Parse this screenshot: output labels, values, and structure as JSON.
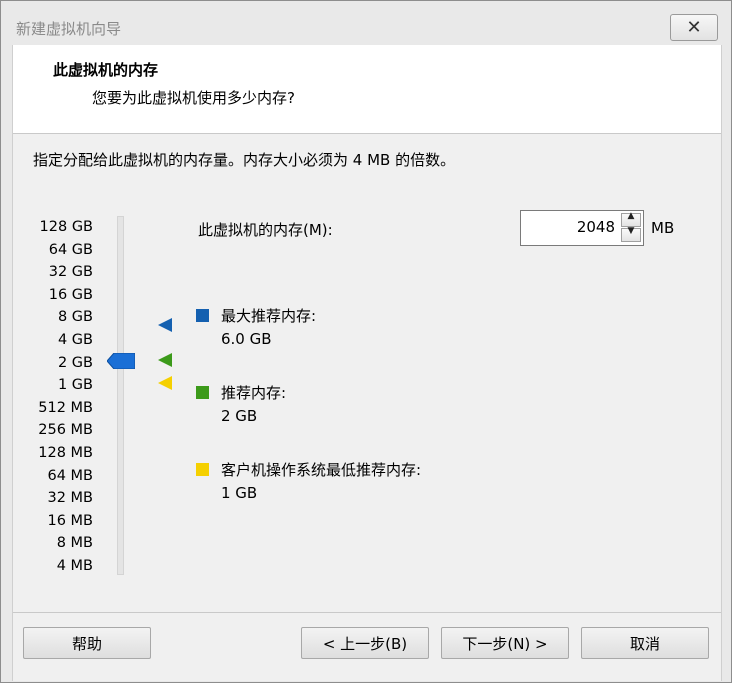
{
  "window": {
    "title": "新建虚拟机向导",
    "close_glyph": "✕"
  },
  "header": {
    "title": "此虚拟机的内存",
    "subtitle": "您要为此虚拟机使用多少内存?"
  },
  "description": "指定分配给此虚拟机的内存量。内存大小必须为 4 MB 的倍数。",
  "slider": {
    "ticks": [
      "128 GB",
      "64 GB",
      "32 GB",
      "16 GB",
      "8 GB",
      "4 GB",
      "2 GB",
      "1 GB",
      "512 MB",
      "256 MB",
      "128 MB",
      "64 MB",
      "32 MB",
      "16 MB",
      "8 MB",
      "4 MB"
    ],
    "current": "2 GB"
  },
  "memory": {
    "label": "此虚拟机的内存(M):",
    "value": "2048",
    "unit": "MB"
  },
  "recommendations": [
    {
      "label": "最大推荐内存:",
      "value": "6.0 GB",
      "color": "#1460b0"
    },
    {
      "label": "推荐内存:",
      "value": "2 GB",
      "color": "#3c9a1a"
    },
    {
      "label": "客户机操作系统最低推荐内存:",
      "value": "1 GB",
      "color": "#f5d000"
    }
  ],
  "buttons": {
    "help": "帮助",
    "back": "< 上一步(B)",
    "next": "下一步(N) >",
    "cancel": "取消"
  },
  "colors": {
    "thumb": "#1a6fd6"
  }
}
